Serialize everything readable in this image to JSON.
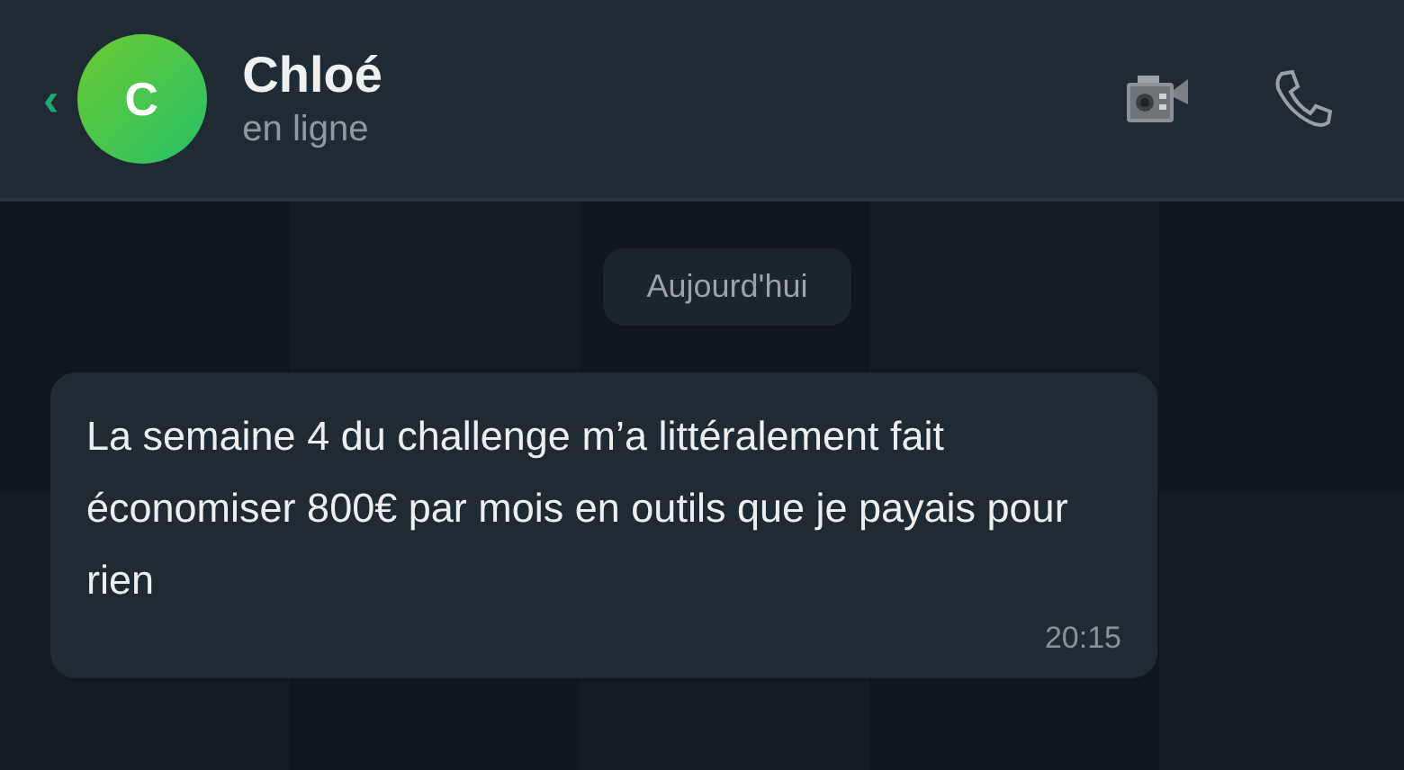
{
  "header": {
    "back": "‹",
    "avatar_letter": "C",
    "name": "Chloé",
    "status": "en ligne"
  },
  "date_separator": "Aujourd'hui",
  "messages": [
    {
      "text": "La semaine 4 du challenge m’a littéralement fait économiser 800€ par mois en outils que je payais pour rien",
      "time": "20:15"
    }
  ]
}
